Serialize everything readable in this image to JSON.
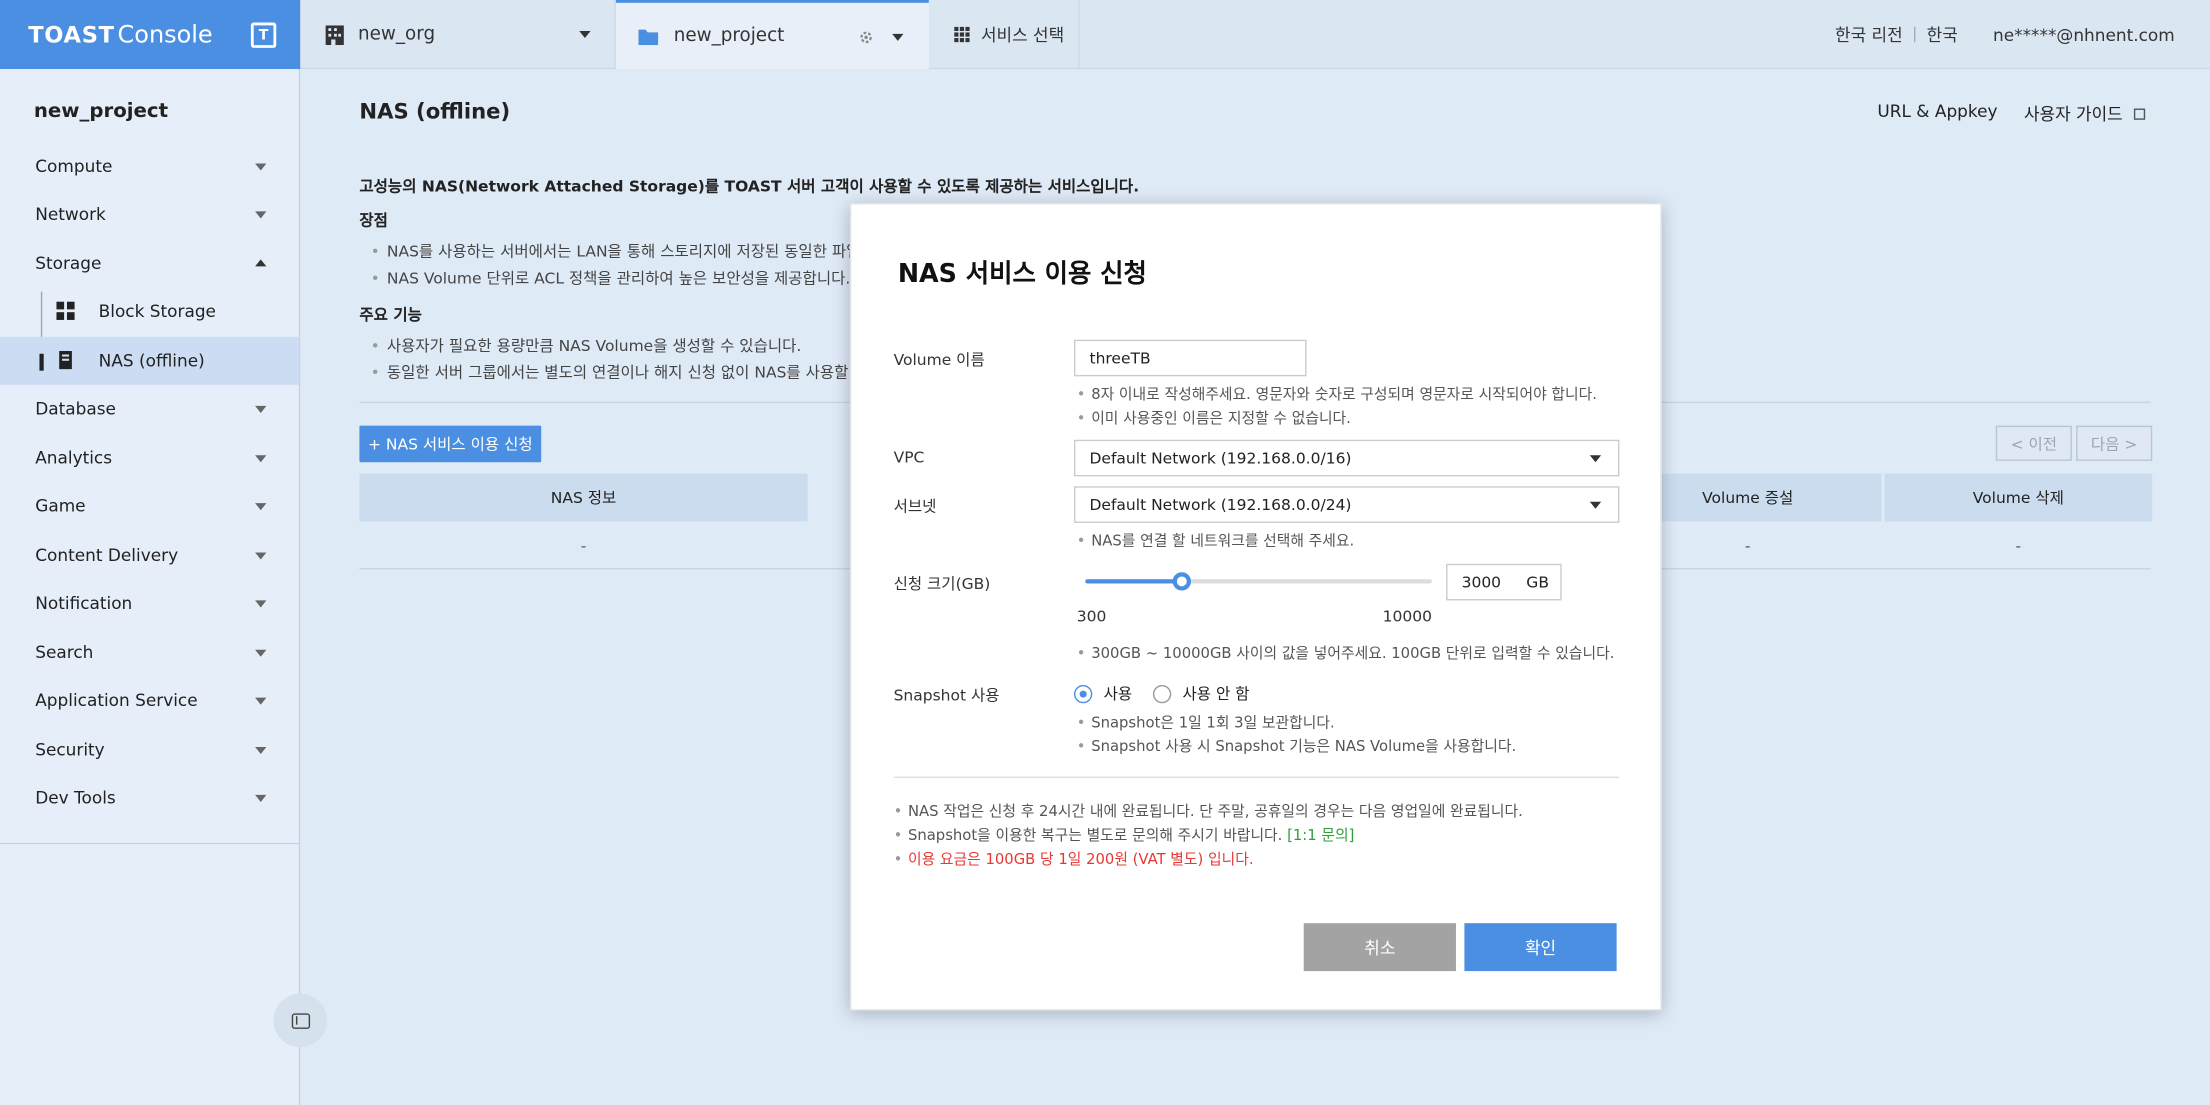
{
  "brand": {
    "logo": "TOAST",
    "product": "Console",
    "badge": "T"
  },
  "topbar": {
    "org_name": "new_org",
    "project_name": "new_project",
    "service_select": "서비스 선택",
    "region": "한국 리전",
    "language": "한국",
    "user_email": "ne*****@nhnent.com"
  },
  "sidebar": {
    "project_title": "new_project",
    "items": [
      {
        "label": "Compute"
      },
      {
        "label": "Network"
      },
      {
        "label": "Storage"
      },
      {
        "label": "Database"
      },
      {
        "label": "Analytics"
      },
      {
        "label": "Game"
      },
      {
        "label": "Content Delivery"
      },
      {
        "label": "Notification"
      },
      {
        "label": "Search"
      },
      {
        "label": "Application Service"
      },
      {
        "label": "Security"
      },
      {
        "label": "Dev Tools"
      }
    ],
    "storage_children": [
      {
        "label": "Block Storage",
        "icon": "grid-icon"
      },
      {
        "label": "NAS (offline)",
        "icon": "server-icon",
        "active": true
      }
    ]
  },
  "main": {
    "title": "NAS (offline)",
    "url_appkey": "URL & Appkey",
    "user_guide": "사용자 가이드",
    "intro": "고성능의 NAS(Network Attached Storage)를 TOAST 서버 고객이 사용할 수 있도록 제공하는 서비스입니다.",
    "advantages_head": "장점",
    "advantages": [
      "NAS를 사용하는 서버에서는 LAN을 통해 스토리지에 저장된 동일한 파일에 ",
      "NAS Volume 단위로 ACL 정책을 관리하여 높은 보안성을 제공합니다."
    ],
    "features_head": "주요 기능",
    "features": [
      "사용자가 필요한 용량만큼 NAS Volume을 생성할 수 있습니다.",
      "동일한 서버 그룹에서는 별도의 연결이나 해지 신청 없이 NAS를 사용할 수 있"
    ],
    "apply_button": "+ NAS 서비스 이용 신청",
    "prev": "< 이전",
    "next": "다음 >",
    "table": {
      "headers": [
        "NAS 정보",
        "Volume 증설",
        "Volume 삭제"
      ],
      "row": [
        "-",
        "-",
        "-"
      ]
    }
  },
  "modal": {
    "title": "NAS 서비스 이용 신청",
    "volume_label": "Volume 이름",
    "volume_value": "threeTB",
    "volume_notes": [
      "8자 이내로 작성해주세요. 영문자와 숫자로 구성되며 영문자로 시작되어야 합니다.",
      "이미 사용중인 이름은 지정할 수 없습니다."
    ],
    "vpc_label": "VPC",
    "vpc_value": "Default Network (192.168.0.0/16)",
    "subnet_label": "서브넷",
    "subnet_value": "Default Network (192.168.0.0/24)",
    "subnet_note": "NAS를 연결 할 네트워크를 선택해 주세요.",
    "size_label": "신청 크기(GB)",
    "size_value": "3000",
    "size_unit": "GB",
    "size_min": "300",
    "size_max": "10000",
    "size_slider_fraction": 0.278,
    "size_note": "300GB ~ 10000GB 사이의 값을 넣어주세요. 100GB 단위로 입력할 수 있습니다.",
    "snapshot_label": "Snapshot 사용",
    "snapshot_on": "사용",
    "snapshot_off": "사용 안 함",
    "snapshot_notes": [
      "Snapshot은 1일 1회 3일 보관합니다.",
      "Snapshot 사용 시 Snapshot 기능은 NAS Volume을 사용합니다."
    ],
    "footer_notes": [
      "NAS 작업은 신청 후 24시간 내에 완료됩니다. 단 주말, 공휴일의 경우는 다음 영업일에 완료됩니다.",
      "Snapshot을 이용한 복구는 별도로 문의해 주시기 바랍니다. ",
      "이용 요금은 100GB 당 1일 200원 (VAT 별도) 입니다."
    ],
    "inquiry_link": "[1:1 문의]",
    "cancel": "취소",
    "confirm": "확인"
  },
  "colors": {
    "accent": "#4b8fe2",
    "warning": "#e53935",
    "link_green": "#2e9f3a"
  }
}
